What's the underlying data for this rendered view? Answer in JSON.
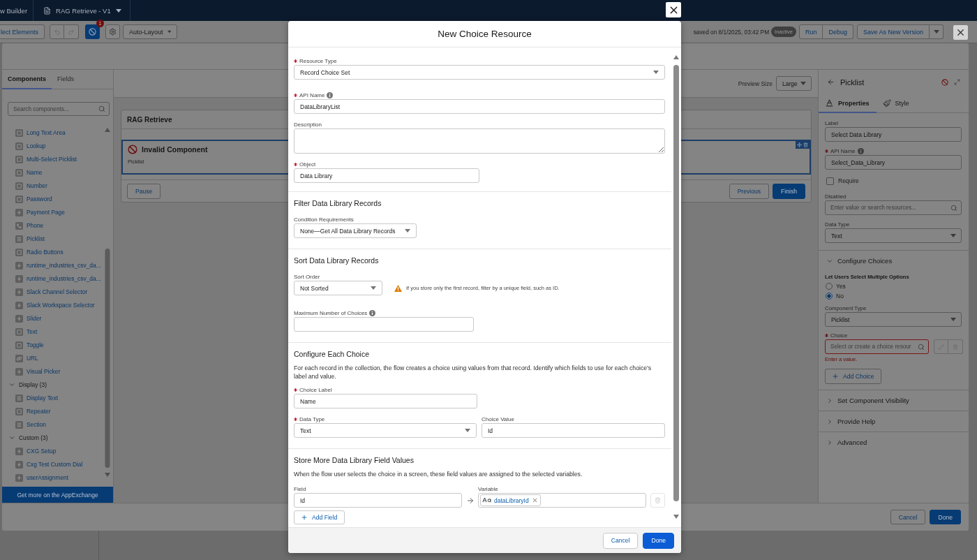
{
  "app_header": {
    "title": "w Builder",
    "flow_name": "RAG Retrieve - V1"
  },
  "toolbar": {
    "select_button": "lect Elements",
    "history_buttons": [
      {
        "kind": "undo",
        "disabled": true
      },
      {
        "kind": "redo",
        "disabled": true
      }
    ],
    "error_count": "1",
    "layout": "Auto-Layout",
    "saved_status": "saved on 8/1/2025, 03:42 PM",
    "status_badge": "Inactive",
    "run_buttons": [
      "Run",
      "Debug"
    ],
    "save_button": "Save As New Version"
  },
  "screen_editor": {
    "palette": {
      "tabs": [
        {
          "label": "Components",
          "selected": true
        },
        {
          "label": "Fields",
          "selected": false
        }
      ],
      "search": {
        "placeholder": "Search components..."
      },
      "groups": [
        {
          "items": [
            {
              "label": "Long Text Area",
              "kind": "field"
            },
            {
              "label": "Lookup",
              "kind": "field"
            },
            {
              "label": "Multi-Select Picklist",
              "kind": "field"
            },
            {
              "label": "Name",
              "kind": "field"
            },
            {
              "label": "Number",
              "kind": "field"
            },
            {
              "label": "Password",
              "kind": "field"
            },
            {
              "label": "Payment Page",
              "kind": "lightning"
            },
            {
              "label": "Phone",
              "kind": "phone"
            },
            {
              "label": "Picklist",
              "kind": "list"
            },
            {
              "label": "Radio Buttons",
              "kind": "field"
            },
            {
              "label": "runtime_industries_csv_da...",
              "kind": "lightning"
            },
            {
              "label": "runtime_industries_csv_da...",
              "kind": "lightning"
            },
            {
              "label": "Slack Channel Selector",
              "kind": "lightning"
            },
            {
              "label": "Slack Workspace Selector",
              "kind": "lightning"
            },
            {
              "label": "Slider",
              "kind": "lightning"
            },
            {
              "label": "Text",
              "kind": "field"
            },
            {
              "label": "Toggle",
              "kind": "field"
            },
            {
              "label": "URL",
              "kind": "link"
            },
            {
              "label": "Visual Picker",
              "kind": "lightning"
            }
          ]
        },
        {
          "label": "Display (3)",
          "expanded": true,
          "items": [
            {
              "label": "Display Text",
              "kind": "list"
            },
            {
              "label": "Repeater",
              "kind": "field"
            },
            {
              "label": "Section",
              "kind": "list"
            }
          ]
        },
        {
          "label": "Custom (3)",
          "expanded": true,
          "items": [
            {
              "label": "CXG Setup",
              "kind": "lightning"
            },
            {
              "label": "Cxg Test Custom Dial",
              "kind": "lightning"
            },
            {
              "label": "userAssignment",
              "kind": "lightning"
            }
          ]
        }
      ],
      "footer_button": "Get more on the AppExchange"
    },
    "preview": {
      "label": "Preview Size",
      "value": "Large"
    },
    "screen": {
      "title": "RAG Retrieve",
      "components": [
        {
          "title": "Invalid Component",
          "type": "Picklist",
          "selected": true,
          "invalid": true
        }
      ],
      "left_buttons": [
        "Pause"
      ],
      "right_buttons": [
        {
          "label": "Previous",
          "kind": "neutral"
        },
        {
          "label": "Finish",
          "kind": "brand"
        }
      ]
    },
    "properties": {
      "title": "Picklist",
      "has_error": true,
      "tabs": [
        {
          "label": "Properties",
          "kind": "text",
          "selected": true
        },
        {
          "label": "Style",
          "kind": "brush",
          "selected": false
        }
      ],
      "fields": [
        {
          "kind": "input",
          "label": "Label",
          "value": "Select Data Library"
        },
        {
          "kind": "input",
          "label": "API Name",
          "required": true,
          "info": true,
          "value": "Select_Data_Library"
        },
        {
          "kind": "checkbox",
          "label": "Require",
          "checked": false
        },
        {
          "kind": "search",
          "label": "Disabled",
          "placeholder": "Enter value or search resources..."
        },
        {
          "kind": "select",
          "label": "Data Type",
          "value": "Text"
        }
      ],
      "sections": [
        {
          "title": "Configure Choices",
          "expanded": true,
          "content": {
            "multi_select": {
              "label": "Let Users Select Multiple Options",
              "options": [
                {
                  "label": "Yes",
                  "selected": false
                },
                {
                  "label": "No",
                  "selected": true
                }
              ]
            },
            "component_type": {
              "label": "Component Type",
              "value": "Picklist"
            },
            "choice": {
              "label": "Choice",
              "required": true,
              "placeholder": "Select or create a choice resour",
              "error": "Enter a value.",
              "actions_disabled": true
            },
            "add_button": "Add Choice"
          }
        },
        {
          "title": "Set Component Visibility",
          "expanded": false
        },
        {
          "title": "Provide Help",
          "expanded": false
        },
        {
          "title": "Advanced",
          "expanded": false
        }
      ]
    },
    "footer": [
      {
        "label": "Cancel",
        "kind": "neutral"
      },
      {
        "label": "Done",
        "kind": "brand"
      }
    ]
  },
  "dialog": {
    "title": "New Choice Resource",
    "fields": [
      {
        "kind": "select",
        "label": "Resource Type",
        "required": true,
        "value": "Record Choice Set"
      },
      {
        "kind": "input",
        "label": "API Name",
        "required": true,
        "info": true,
        "value": "DataLibraryList"
      },
      {
        "kind": "textarea",
        "label": "Description"
      },
      {
        "kind": "input",
        "label": "Object",
        "required": true,
        "value": "Data Library"
      }
    ],
    "sections": [
      {
        "title": "Filter Data Library Records",
        "fields": [
          {
            "kind": "select",
            "label": "Condition Requirements",
            "value": "None—Get All Data Library Records"
          }
        ]
      },
      {
        "title": "Sort Data Library Records",
        "fields": [
          {
            "kind": "select",
            "label": "Sort Order",
            "value": "Not Sorted",
            "warning": "If you store only the first record, filter by a unique field, such as ID."
          },
          {
            "kind": "input",
            "label": "Maximum Number of Choices",
            "info": true
          }
        ]
      },
      {
        "title": "Configure Each Choice",
        "description": "For each record in the collection, the flow creates a choice using values from that record. Identify which fields to use for each choice's label and value.",
        "fields": [
          {
            "kind": "input",
            "label": "Choice Label",
            "required": true,
            "value": "Name"
          },
          {
            "kind": "select",
            "label": "Data Type",
            "required": true,
            "value": "Text"
          },
          {
            "kind": "input",
            "label": "Choice Value",
            "value": "Id"
          }
        ]
      },
      {
        "title": "Store More Data Library Field Values",
        "description": "When the flow user selects the choice in a screen, these field values are assigned to the selected variables.",
        "mappings": [
          {
            "field_label": "Field",
            "field": "Id",
            "variable_label": "Variable",
            "variable": "dataLibraryId",
            "delete_disabled": true
          }
        ],
        "add_button": "Add Field"
      }
    ],
    "footer": [
      {
        "label": "Cancel",
        "kind": "neutral"
      },
      {
        "label": "Done",
        "kind": "brand"
      }
    ]
  }
}
